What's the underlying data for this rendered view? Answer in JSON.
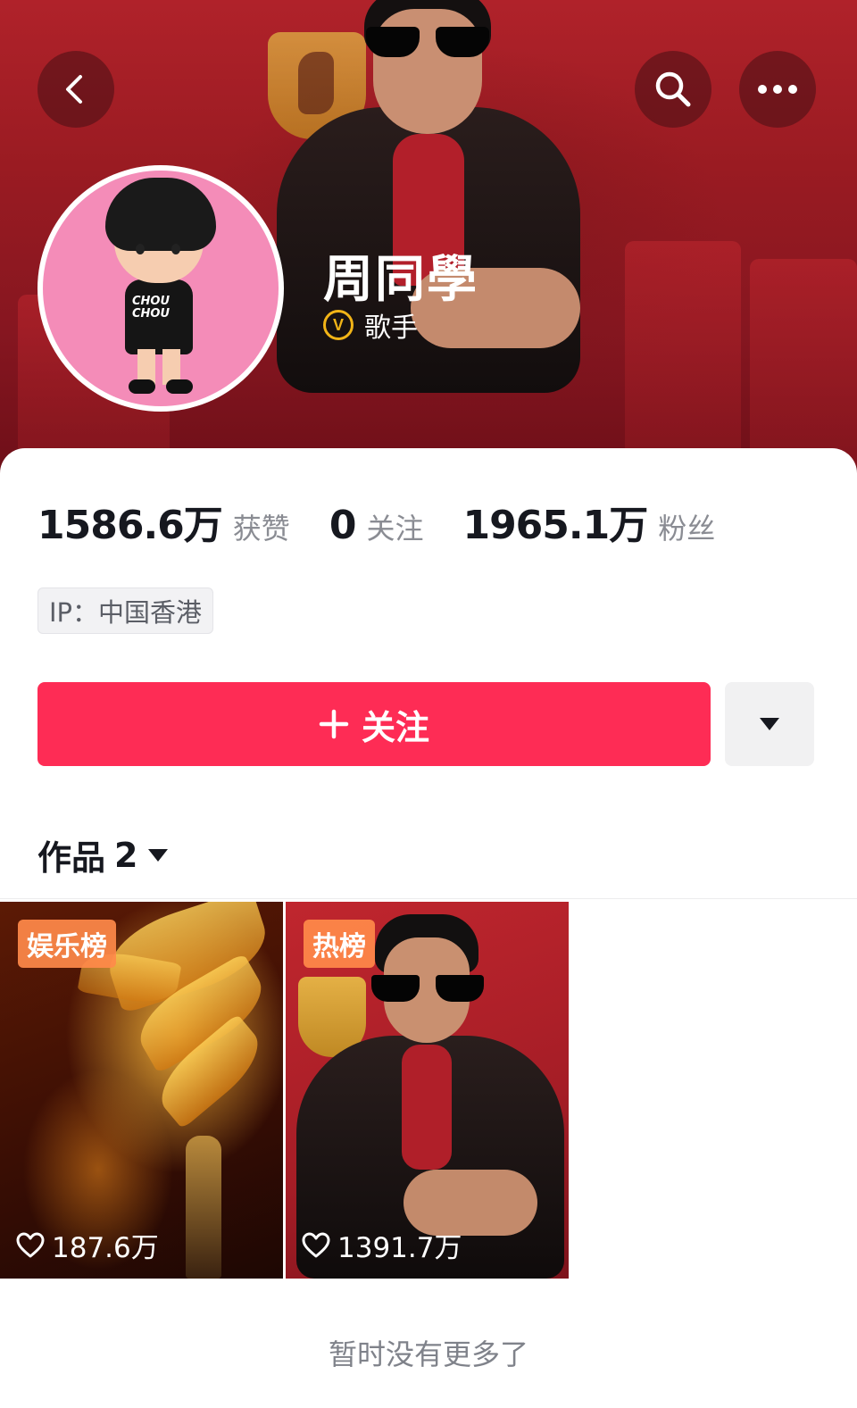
{
  "header": {
    "back_icon": "chevron-left-icon",
    "search_icon": "search-icon",
    "more_icon": "ellipsis-icon"
  },
  "profile": {
    "name": "周同學",
    "verify_badge": "V",
    "verify_label": "歌手",
    "verify_color": "#f2b417"
  },
  "stats": [
    {
      "value": "1586.6万",
      "label": "获赞"
    },
    {
      "value": "0",
      "label": "关注"
    },
    {
      "value": "1965.1万",
      "label": "粉丝"
    }
  ],
  "ip": "IP：中国香港",
  "actions": {
    "follow_label": "关注",
    "follow_color": "#fe2c55",
    "more_icon": "caret-down-icon"
  },
  "works": {
    "label": "作品",
    "count": "2"
  },
  "videos": [
    {
      "tag": "娱乐榜",
      "likes": "187.6万"
    },
    {
      "tag": "热榜",
      "likes": "1391.7万"
    }
  ],
  "footer": {
    "no_more": "暂时没有更多了"
  }
}
